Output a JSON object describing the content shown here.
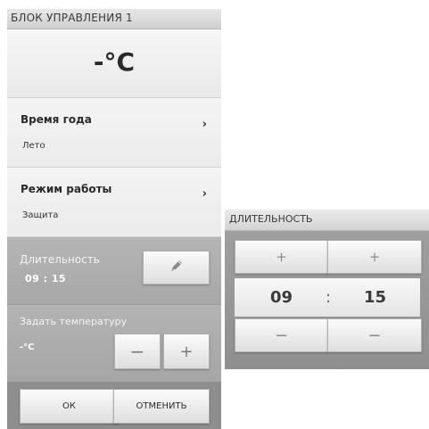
{
  "control_panel": {
    "title": "БЛОК УПРАВЛЕНИЯ 1",
    "current_temperature": "-°C",
    "season": {
      "label": "Время года",
      "value": "Лето",
      "chevron": "›"
    },
    "mode": {
      "label": "Режим работы",
      "value": "Защита",
      "chevron": "›"
    },
    "duration": {
      "label": "Длительность",
      "value": "09  :  15",
      "edit_icon": "pencil-icon"
    },
    "set_temperature": {
      "label": "Задать температуру",
      "value": "-°C",
      "minus": "−",
      "plus": "+"
    },
    "ok_label": "ОК",
    "cancel_label": "ОТМЕНИТЬ"
  },
  "duration_dialog": {
    "title": "ДЛИТЕЛЬНОСТЬ",
    "plus_label": "+",
    "minus_label": "−",
    "hours": "09",
    "separator": ":",
    "minutes": "15"
  }
}
